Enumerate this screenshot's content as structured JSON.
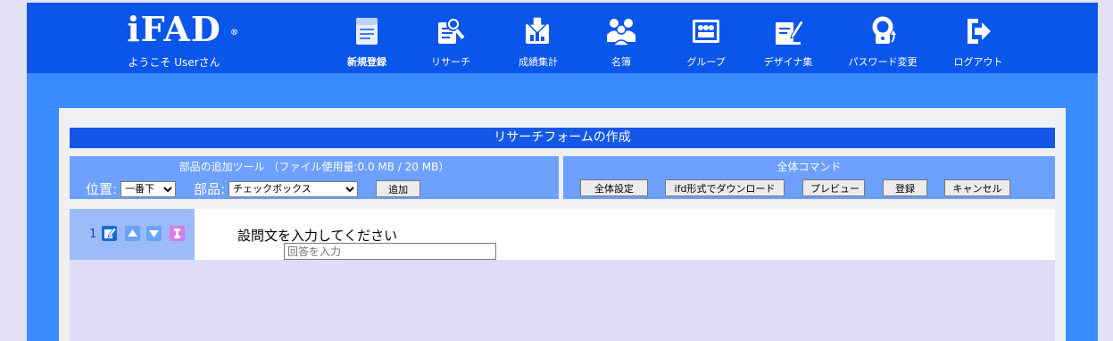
{
  "header": {
    "brand": "iFAD",
    "brand_mark": "®",
    "welcome": "ようこそ Userさん",
    "nav": [
      {
        "label": "新規登録",
        "icon": "new-registration-icon",
        "active": true
      },
      {
        "label": "リサーチ",
        "icon": "research-icon"
      },
      {
        "label": "成績集計",
        "icon": "results-tally-icon"
      },
      {
        "label": "名簿",
        "icon": "roster-icon"
      },
      {
        "label": "グループ",
        "icon": "group-icon"
      },
      {
        "label": "デザイナ集",
        "icon": "designer-icon"
      },
      {
        "label": "パスワード変更",
        "icon": "password-change-icon"
      },
      {
        "label": "ログアウト",
        "icon": "logout-icon"
      }
    ]
  },
  "form": {
    "title": "リサーチフォームの作成"
  },
  "tools": {
    "title": "部品の追加ツール （ファイル使用量:0.0 MB / 20 MB）",
    "position_label": "位置:",
    "position_value": "一番下",
    "part_label": "部品:",
    "part_value": "チェックボックス",
    "add_button": "追加"
  },
  "commands": {
    "title": "全体コマンド",
    "buttons": [
      "全体設定",
      "ifd形式でダウンロード",
      "プレビュー",
      "登録",
      "キャンセル"
    ]
  },
  "question": {
    "number": "1",
    "text": "設問文を入力してください",
    "answer_placeholder": "回答を入力"
  },
  "colors": {
    "header_blue": "#0a56ea",
    "band_blue": "#3a8cff",
    "title_blue": "#1558e8",
    "tool_blue": "#6da0ff",
    "question_side": "#9bbcf9",
    "page_bg": "#e3e2f6"
  }
}
